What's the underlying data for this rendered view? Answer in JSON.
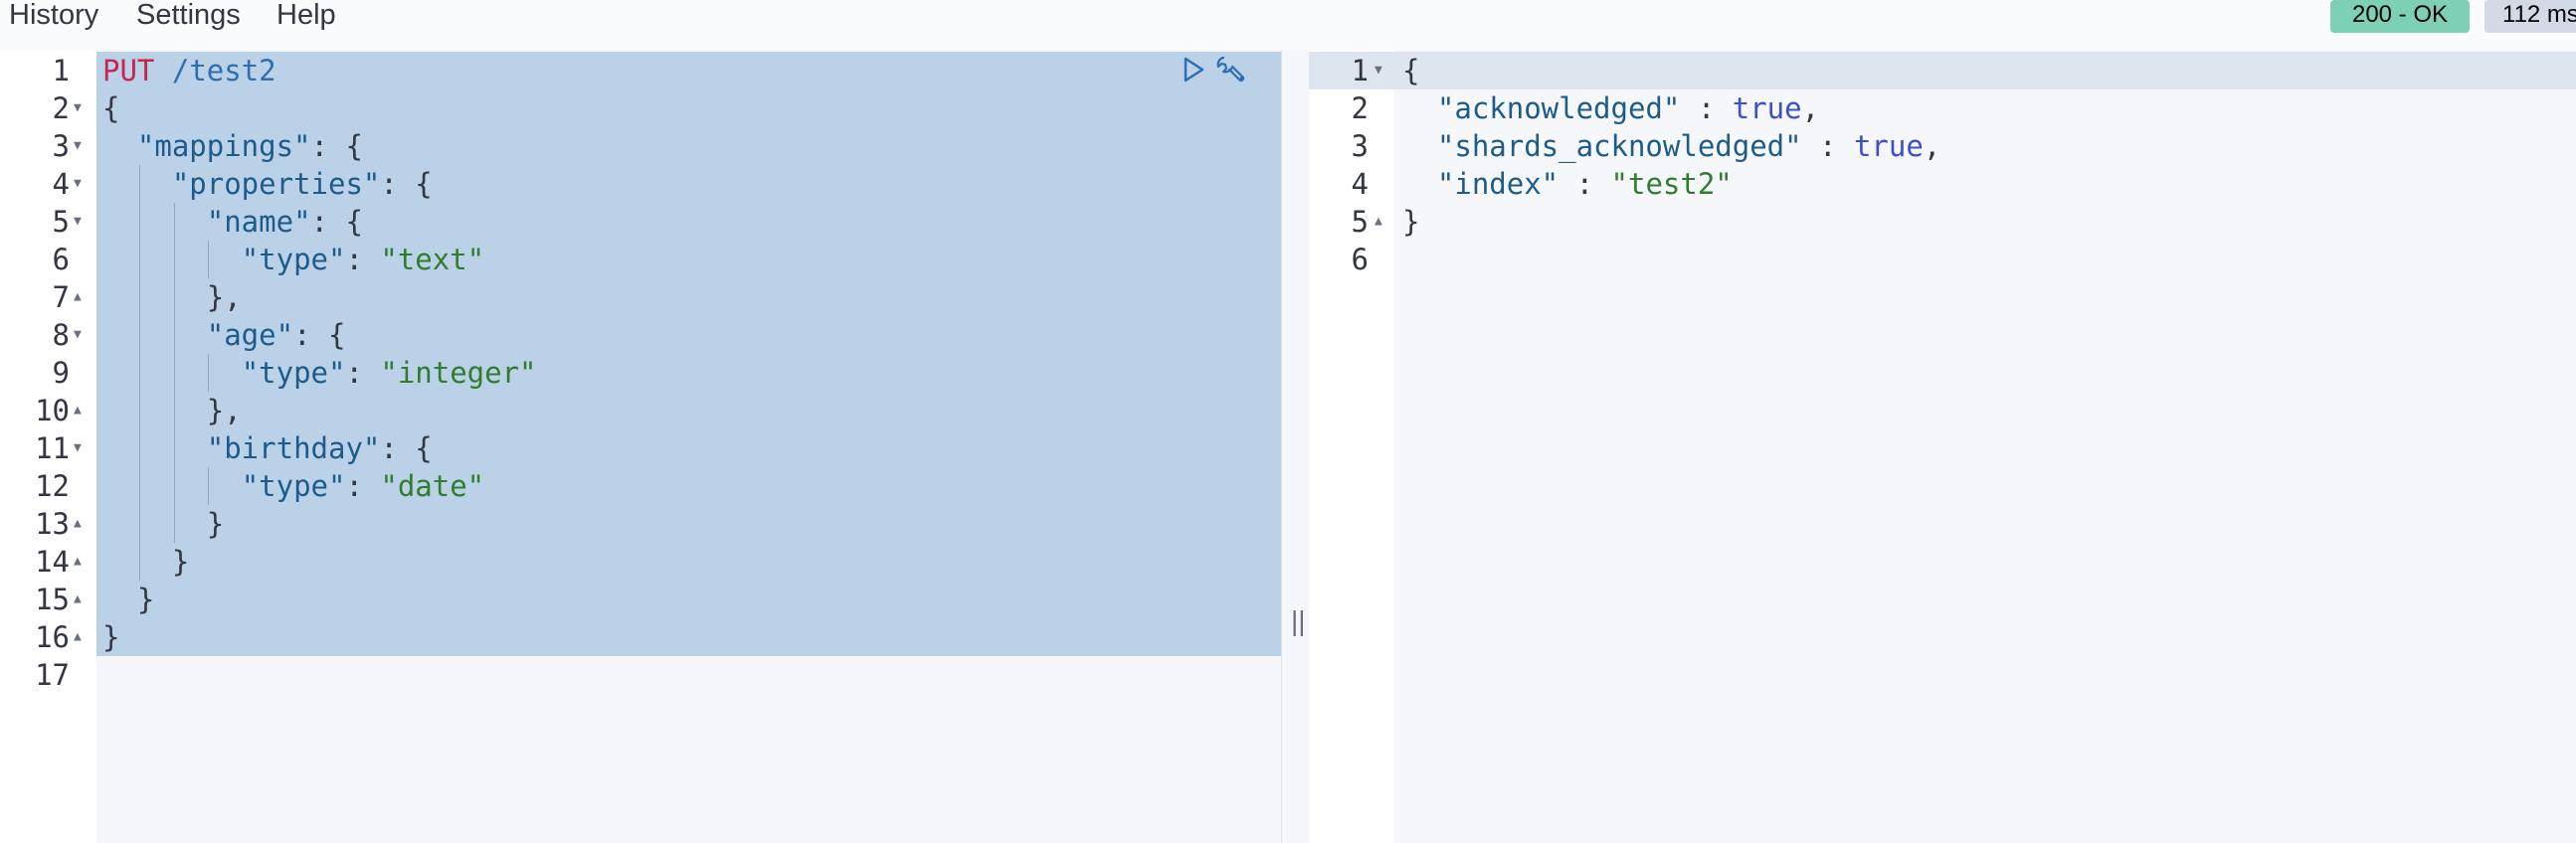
{
  "menu": {
    "history": "History",
    "settings": "Settings",
    "help": "Help"
  },
  "status": {
    "code": "200 - OK",
    "time": "112 ms"
  },
  "request": {
    "line_numbers": [
      "1",
      "2",
      "3",
      "4",
      "5",
      "6",
      "7",
      "8",
      "9",
      "10",
      "11",
      "12",
      "13",
      "14",
      "15",
      "16",
      "17"
    ],
    "method": "PUT",
    "url": "/test2",
    "lines": [
      {
        "indent": 0,
        "tokens": [
          {
            "t": "p",
            "v": "{"
          }
        ]
      },
      {
        "indent": 1,
        "tokens": [
          {
            "t": "key",
            "v": "\"mappings\""
          },
          {
            "t": "p",
            "v": ": {"
          }
        ]
      },
      {
        "indent": 2,
        "tokens": [
          {
            "t": "key",
            "v": "\"properties\""
          },
          {
            "t": "p",
            "v": ": {"
          }
        ]
      },
      {
        "indent": 3,
        "tokens": [
          {
            "t": "key",
            "v": "\"name\""
          },
          {
            "t": "p",
            "v": ": {"
          }
        ]
      },
      {
        "indent": 4,
        "tokens": [
          {
            "t": "key",
            "v": "\"type\""
          },
          {
            "t": "p",
            "v": ": "
          },
          {
            "t": "str",
            "v": "\"text\""
          }
        ]
      },
      {
        "indent": 3,
        "tokens": [
          {
            "t": "p",
            "v": "},"
          }
        ]
      },
      {
        "indent": 3,
        "tokens": [
          {
            "t": "key",
            "v": "\"age\""
          },
          {
            "t": "p",
            "v": ": {"
          }
        ]
      },
      {
        "indent": 4,
        "tokens": [
          {
            "t": "key",
            "v": "\"type\""
          },
          {
            "t": "p",
            "v": ": "
          },
          {
            "t": "str",
            "v": "\"integer\""
          }
        ]
      },
      {
        "indent": 3,
        "tokens": [
          {
            "t": "p",
            "v": "},"
          }
        ]
      },
      {
        "indent": 3,
        "tokens": [
          {
            "t": "key",
            "v": "\"birthday\""
          },
          {
            "t": "p",
            "v": ": {"
          }
        ]
      },
      {
        "indent": 4,
        "tokens": [
          {
            "t": "key",
            "v": "\"type\""
          },
          {
            "t": "p",
            "v": ": "
          },
          {
            "t": "str",
            "v": "\"date\""
          }
        ]
      },
      {
        "indent": 3,
        "tokens": [
          {
            "t": "p",
            "v": "}"
          }
        ]
      },
      {
        "indent": 2,
        "tokens": [
          {
            "t": "p",
            "v": "}"
          }
        ]
      },
      {
        "indent": 1,
        "tokens": [
          {
            "t": "p",
            "v": "}"
          }
        ]
      },
      {
        "indent": 0,
        "tokens": [
          {
            "t": "p",
            "v": "}"
          }
        ]
      },
      {
        "indent": 0,
        "tokens": []
      }
    ]
  },
  "response": {
    "line_numbers": [
      "1",
      "2",
      "3",
      "4",
      "5",
      "6"
    ],
    "lines": [
      {
        "indent": 0,
        "tokens": [
          {
            "t": "p",
            "v": "{"
          }
        ]
      },
      {
        "indent": 1,
        "tokens": [
          {
            "t": "key",
            "v": "\"acknowledged\""
          },
          {
            "t": "p",
            "v": " : "
          },
          {
            "t": "bool",
            "v": "true"
          },
          {
            "t": "p",
            "v": ","
          }
        ]
      },
      {
        "indent": 1,
        "tokens": [
          {
            "t": "key",
            "v": "\"shards_acknowledged\""
          },
          {
            "t": "p",
            "v": " : "
          },
          {
            "t": "bool",
            "v": "true"
          },
          {
            "t": "p",
            "v": ","
          }
        ]
      },
      {
        "indent": 1,
        "tokens": [
          {
            "t": "key",
            "v": "\"index\""
          },
          {
            "t": "p",
            "v": " : "
          },
          {
            "t": "str",
            "v": "\"test2\""
          }
        ]
      },
      {
        "indent": 0,
        "tokens": [
          {
            "t": "p",
            "v": "}"
          }
        ]
      },
      {
        "indent": 0,
        "tokens": []
      }
    ]
  }
}
